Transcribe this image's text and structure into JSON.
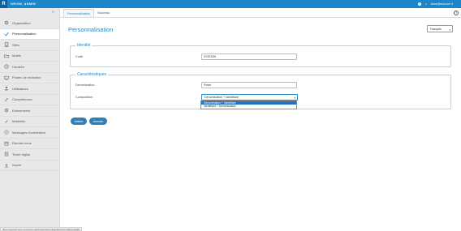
{
  "topbar": {
    "logo_letter": "R",
    "brand": "ORION_ADMIN",
    "user_email": "chloe@ecl.com",
    "help_icon": "question-circle-icon",
    "accent": "#1c86c8"
  },
  "sidebar": {
    "collapse_glyph": "«",
    "items": [
      {
        "label": "Organisation",
        "icon": "gear-icon"
      },
      {
        "label": "Personnalisation",
        "icon": "check-icon",
        "active": true
      },
      {
        "label": "Sites",
        "icon": "building-icon"
      },
      {
        "label": "Motifs",
        "icon": "folder-icon"
      },
      {
        "label": "Horaires",
        "icon": "clock-icon"
      },
      {
        "label": "Postes de réception",
        "icon": "desk-icon"
      },
      {
        "label": "Utilisateurs",
        "icon": "user-icon"
      },
      {
        "label": "Compétences",
        "icon": "tools-icon"
      },
      {
        "label": "Evénements",
        "icon": "gear-icon"
      },
      {
        "label": "Matériels",
        "icon": "pen-icon"
      },
      {
        "label": "Messages d'orientation",
        "icon": "message-icon"
      },
      {
        "label": "Rendez-vous",
        "icon": "calendar-icon"
      },
      {
        "label": "Ticket digital",
        "icon": "ticket-icon"
      },
      {
        "label": "Import",
        "icon": "download-icon"
      }
    ]
  },
  "status_url": "https://opusctrl.orion.com/orion-admin/accueil/configuration/1/1/1/#personal#",
  "tabs": [
    {
      "label": "Personnalisation",
      "active": true
    },
    {
      "label": "Nouveau",
      "active": false
    }
  ],
  "main": {
    "title": "Personnalisation",
    "language": "Français",
    "identity": {
      "legend": "Identité",
      "code_label": "Code",
      "code_value": "STATION"
    },
    "characteristics": {
      "legend": "Caractéristiques",
      "denomination_label": "Dénomination",
      "denomination_value": "Poste",
      "composition_label": "Composition",
      "composition_value": "Dénomination + Identifiant",
      "options": [
        "Dénomination + Identifiant",
        "Identifiant + Dénomination"
      ]
    },
    "validate_label": "Valider",
    "cancel_label": "Annuler"
  }
}
